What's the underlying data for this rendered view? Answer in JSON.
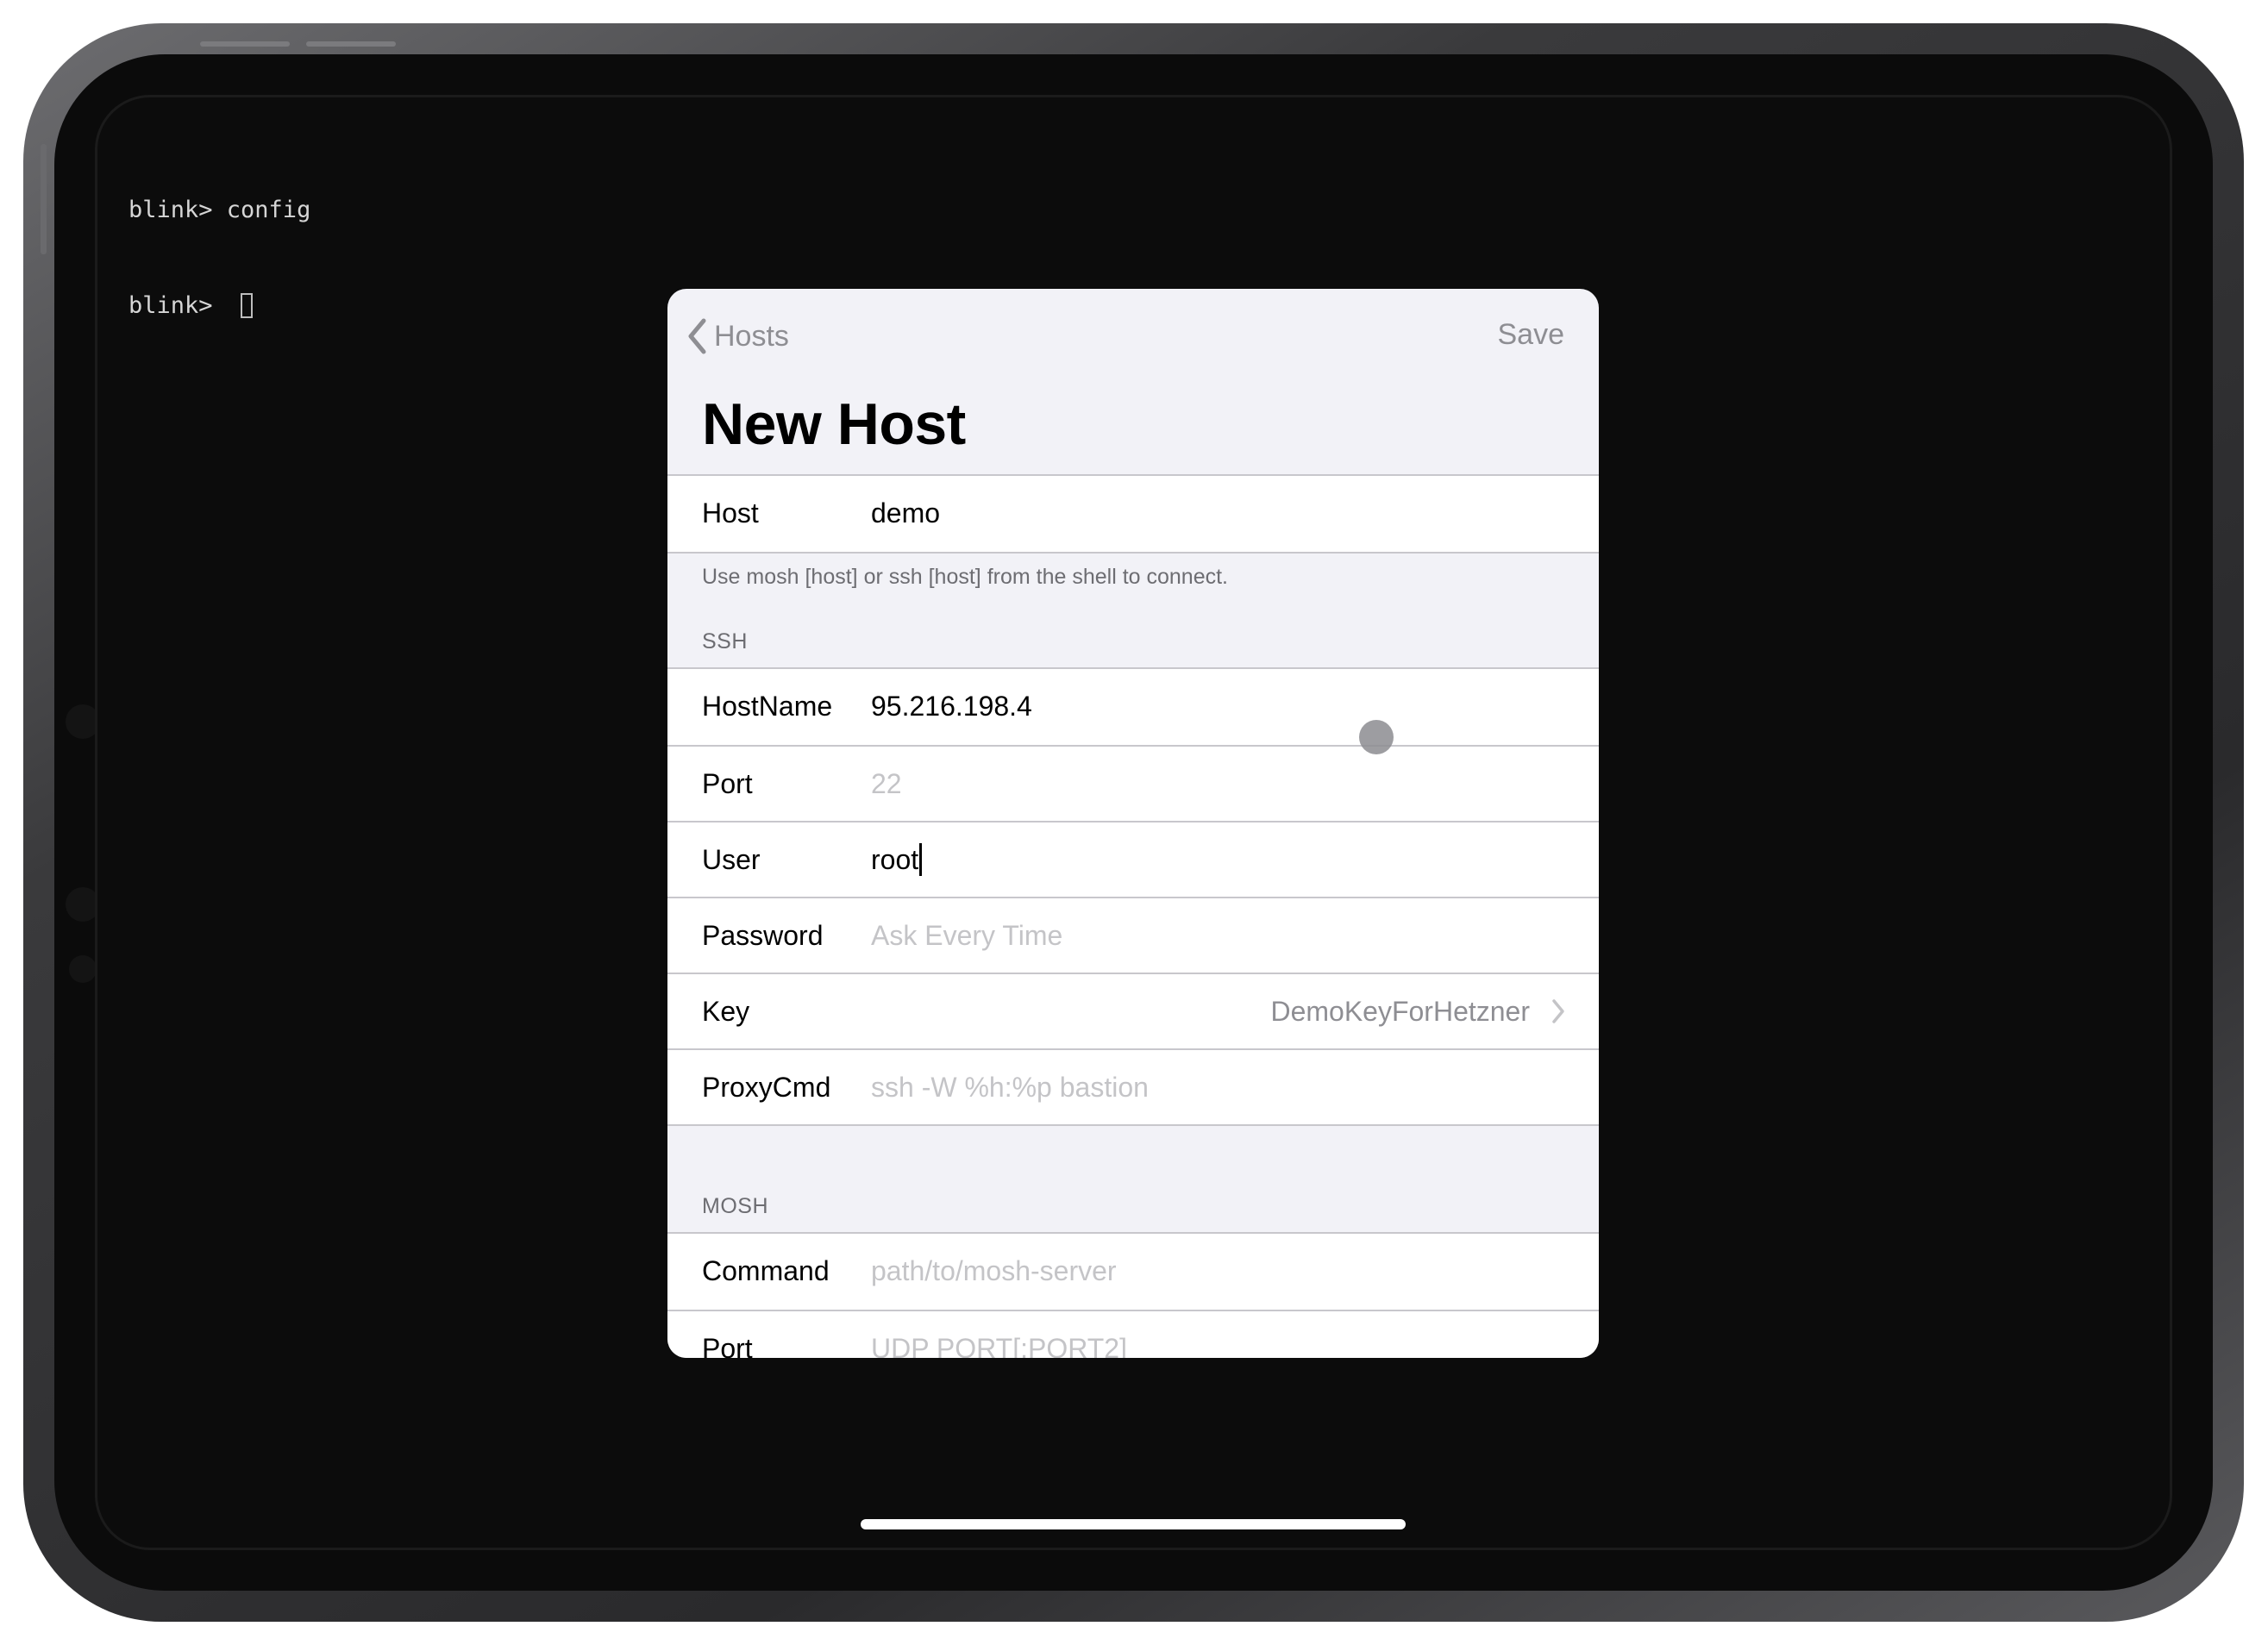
{
  "terminal": {
    "lines": [
      "blink> config",
      "blink> "
    ]
  },
  "nav": {
    "back_label": "Hosts",
    "save_label": "Save",
    "title": "New Host"
  },
  "host_section": {
    "host_label": "Host",
    "host_value": "demo",
    "footer": "Use mosh [host] or ssh [host] from the shell to connect."
  },
  "ssh_section": {
    "header": "SSH",
    "rows": [
      {
        "label": "HostName",
        "value": "95.216.198.4"
      },
      {
        "label": "Port",
        "placeholder": "22"
      },
      {
        "label": "User",
        "value": "root"
      },
      {
        "label": "Password",
        "placeholder": "Ask Every Time"
      },
      {
        "label": "Key",
        "value": "DemoKeyForHetzner"
      },
      {
        "label": "ProxyCmd",
        "placeholder": "ssh -W %h:%p bastion"
      }
    ]
  },
  "mosh_section": {
    "header": "MOSH",
    "rows": [
      {
        "label": "Command",
        "placeholder": "path/to/mosh-server"
      },
      {
        "label": "Port",
        "placeholder": "UDP PORT[:PORT2]"
      }
    ]
  },
  "icons": {
    "back": "chevron-left-icon",
    "disclosure": "chevron-right-icon"
  },
  "colors": {
    "sheet_background": "#f2f2f7",
    "secondary_text": "#8e8e93",
    "placeholder_text": "#c4c4c7"
  }
}
